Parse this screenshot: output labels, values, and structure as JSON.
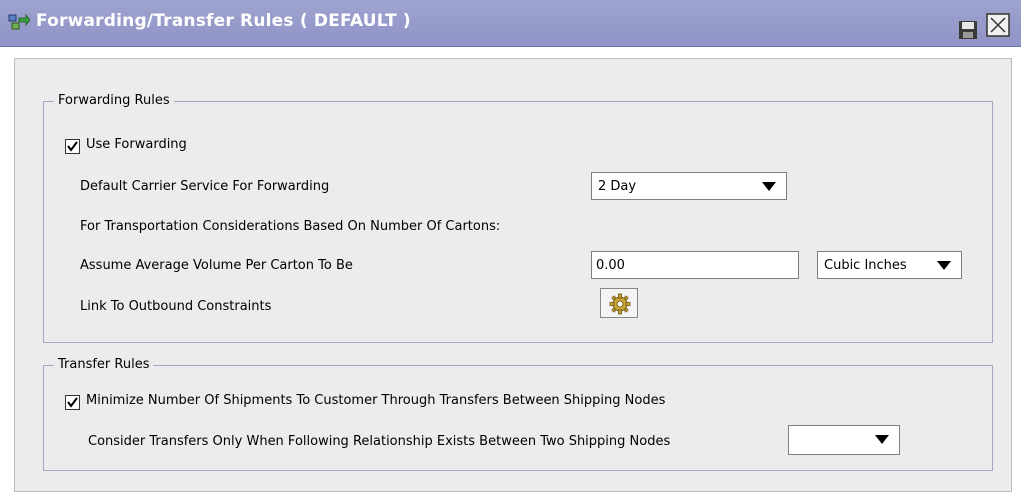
{
  "window": {
    "title": "Forwarding/Transfer Rules ( DEFAULT )"
  },
  "forwarding": {
    "legend": "Forwarding Rules",
    "use_forwarding": {
      "label": "Use Forwarding",
      "checked": true
    },
    "default_carrier_label": "Default Carrier Service For Forwarding",
    "default_carrier_value": "2 Day",
    "transport_note": "For Transportation Considerations Based On Number Of Cartons:",
    "avg_volume_label": "Assume Average Volume Per Carton To Be",
    "avg_volume_value": "0.00",
    "volume_unit": "Cubic Inches",
    "link_label": "Link To Outbound Constraints"
  },
  "transfer": {
    "legend": "Transfer Rules",
    "minimize": {
      "label": "Minimize Number Of Shipments To Customer Through Transfers Between Shipping Nodes",
      "checked": true
    },
    "consider_label": "Consider Transfers Only When Following Relationship Exists Between Two Shipping Nodes",
    "consider_value": ""
  },
  "icons": {
    "title": "rules-icon",
    "save": "save-icon",
    "close": "close-icon",
    "link": "gear-icon"
  }
}
